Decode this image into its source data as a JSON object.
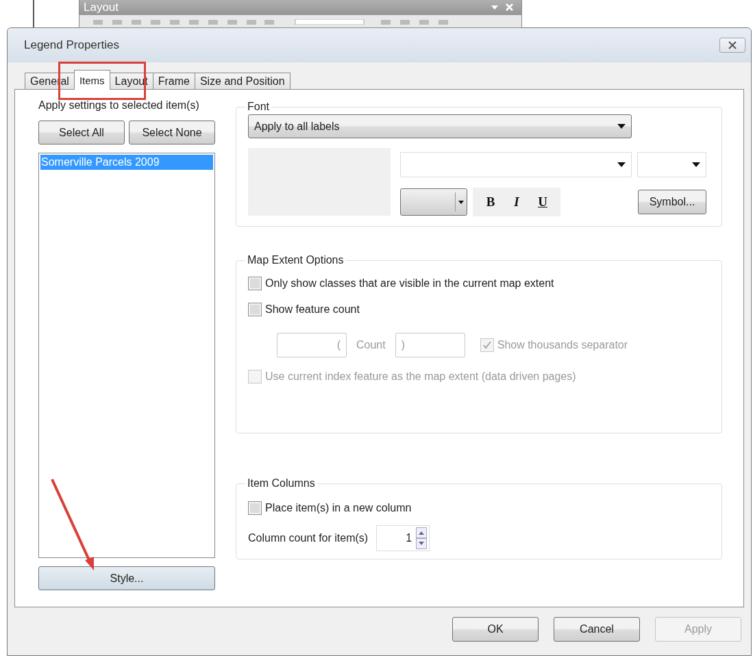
{
  "background_toolbar": {
    "title": "Layout"
  },
  "dialog": {
    "title": "Legend Properties"
  },
  "tabs": [
    {
      "label": "General",
      "selected": false
    },
    {
      "label": "Items",
      "selected": true
    },
    {
      "label": "Layout",
      "selected": false
    },
    {
      "label": "Frame",
      "selected": false
    },
    {
      "label": "Size and Position",
      "selected": false
    }
  ],
  "apply_label": "Apply settings to selected item(s)",
  "select_buttons": [
    "Select All",
    "Select None"
  ],
  "items": [
    {
      "label": "Somerville Parcels 2009",
      "selected": true
    }
  ],
  "style_button": "Style...",
  "font_group": {
    "title": "Font",
    "apply_to": "Apply to all labels",
    "bold": "B",
    "italic": "I",
    "underline": "U",
    "symbol_button": "Symbol..."
  },
  "map_extent": {
    "title": "Map Extent Options",
    "options": [
      {
        "kind": "checkbox",
        "label": "Only show classes that are visible in the current map extent",
        "checked": false,
        "disabled": false
      },
      {
        "kind": "checkbox",
        "label": "Show feature count",
        "checked": false,
        "disabled": false
      },
      {
        "kind": "count",
        "prefix": "(",
        "label": "Count",
        "suffix": ")",
        "separator_label": "Show thousands separator",
        "checked": true,
        "disabled": true
      },
      {
        "kind": "checkbox",
        "label": "Use current index feature as the map extent (data driven pages)",
        "checked": false,
        "disabled": true
      }
    ]
  },
  "item_columns": {
    "title": "Item Columns",
    "new_column": {
      "label": "Place item(s) in a new column",
      "checked": false
    },
    "count_label": "Column count for item(s)",
    "count_value": "1"
  },
  "buttons": [
    {
      "label": "OK",
      "disabled": false
    },
    {
      "label": "Cancel",
      "disabled": false
    },
    {
      "label": "Apply",
      "disabled": true
    }
  ]
}
